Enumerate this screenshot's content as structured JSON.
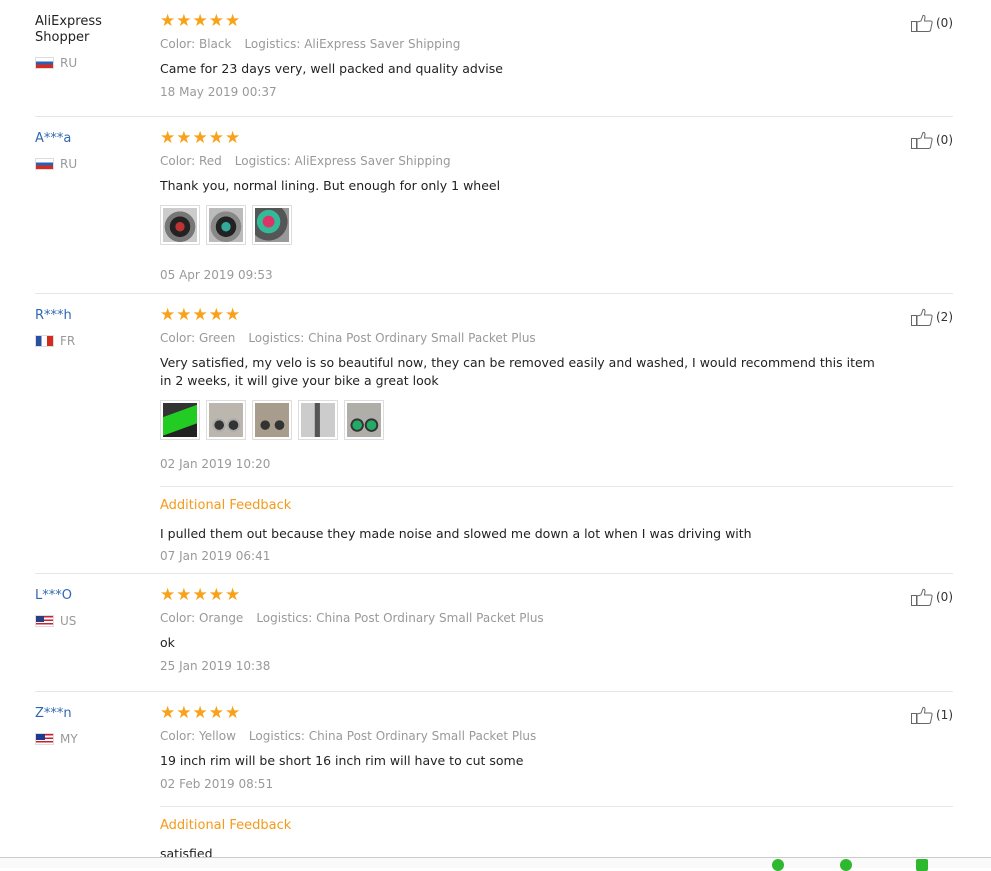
{
  "reviews": [
    {
      "user": "AliExpress Shopper",
      "country": "RU",
      "flag": "ru",
      "stars": "★★★★★",
      "color": "Color: Black",
      "logistics": "Logistics: AliExpress Saver Shipping",
      "text": "Came for 23 days very, well packed and quality advise",
      "date": "18 May 2019 00:37",
      "votes": "(0)"
    },
    {
      "user": "A***a",
      "country": "RU",
      "flag": "ru",
      "stars": "★★★★★",
      "color": "Color: Red",
      "logistics": "Logistics: AliExpress Saver Shipping",
      "text": "Thank you, normal lining. But enough for only 1 wheel",
      "date": "05 Apr 2019 09:53",
      "votes": "(0)"
    },
    {
      "user": "R***h",
      "country": "FR",
      "flag": "fr",
      "stars": "★★★★★",
      "color": "Color: Green",
      "logistics": "Logistics: China Post Ordinary Small Packet Plus",
      "text": "Very satisfied, my velo is so beautiful now, they can be removed easily and washed, I would recommend this item in 2 weeks, it will give your bike a great look",
      "date": "02 Jan 2019 10:20",
      "votes": "(2)",
      "additional_title": "Additional Feedback",
      "additional_text": "I pulled them out because they made noise and slowed me down a lot when I was driving with",
      "additional_date": "07 Jan 2019 06:41"
    },
    {
      "user": "L***O",
      "country": "US",
      "flag": "us",
      "stars": "★★★★★",
      "color": "Color: Orange",
      "logistics": "Logistics: China Post Ordinary Small Packet Plus",
      "text": "ok",
      "date": "25 Jan 2019 10:38",
      "votes": "(0)"
    },
    {
      "user": "Z***n",
      "country": "MY",
      "flag": "my",
      "stars": "★★★★★",
      "color": "Color: Yellow",
      "logistics": "Logistics: China Post Ordinary Small Packet Plus",
      "text": "19 inch rim will be short 16 inch rim will have to cut some",
      "date": "02 Feb 2019 08:51",
      "votes": "(1)",
      "additional_title": "Additional Feedback",
      "additional_text": "satisfied"
    }
  ],
  "colors": {
    "star": "#f8a21b",
    "username": "#2f68b1",
    "additional": "#f39a1c",
    "meta": "#999999"
  },
  "icons": {
    "vote": "thumbs-up-icon"
  }
}
